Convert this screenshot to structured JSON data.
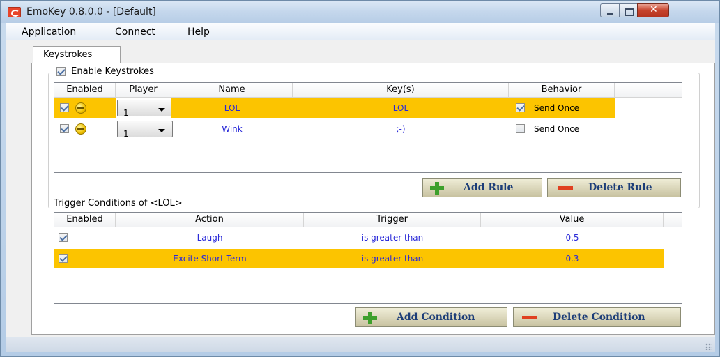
{
  "window": {
    "title": "EmoKey 0.8.0.0 - [Default]"
  },
  "menu": [
    "Application",
    "Connect",
    "Help"
  ],
  "tab": {
    "label": "Keystrokes"
  },
  "keystrokes": {
    "enable_label": "Enable Keystrokes",
    "enable_checked": true,
    "columns": [
      "Enabled",
      "Player",
      "Name",
      "Key(s)",
      "Behavior"
    ],
    "rows": [
      {
        "enabled": true,
        "player": "1",
        "name": "LOL",
        "keys": "LOL",
        "send_once": true,
        "behavior": "Send Once",
        "selected": true
      },
      {
        "enabled": true,
        "player": "1",
        "name": "Wink",
        "keys": ";-)",
        "send_once": false,
        "behavior": "Send Once",
        "selected": false
      }
    ],
    "add_rule": "Add Rule",
    "delete_rule": "Delete Rule"
  },
  "conditions": {
    "label": "Trigger Conditions of <LOL>",
    "columns": [
      "Enabled",
      "Action",
      "Trigger",
      "Value"
    ],
    "rows": [
      {
        "enabled": true,
        "action": "Laugh",
        "trigger": "is greater than",
        "value": "0.5",
        "selected": false
      },
      {
        "enabled": true,
        "action": "Excite Short Term",
        "trigger": "is greater than",
        "value": "0.3",
        "selected": true
      }
    ],
    "add_condition": "Add Condition",
    "delete_condition": "Delete Condition"
  },
  "colors": {
    "selection": "#fcc400",
    "cell_text": "#2a2ad8",
    "button_text": "#1c3d78"
  }
}
